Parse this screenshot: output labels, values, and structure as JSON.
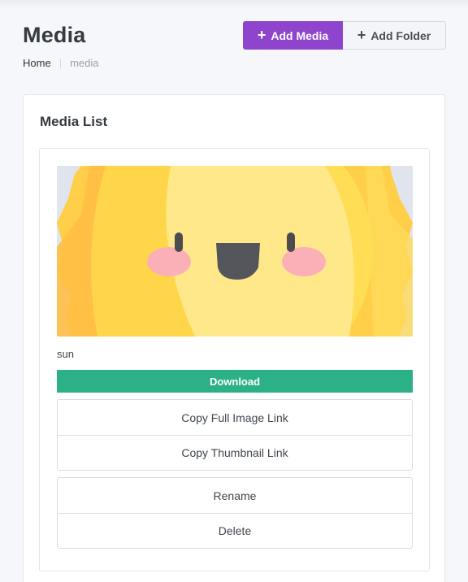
{
  "header": {
    "title": "Media",
    "add_media_label": "Add Media",
    "add_folder_label": "Add Folder"
  },
  "breadcrumb": {
    "home": "Home",
    "current": "media"
  },
  "card": {
    "title": "Media List"
  },
  "media_items": [
    {
      "name": "sun",
      "download_label": "Download",
      "copy_full_label": "Copy Full Image Link",
      "copy_thumb_label": "Copy Thumbnail Link",
      "rename_label": "Rename",
      "delete_label": "Delete"
    }
  ],
  "colors": {
    "accent": "#8e44cc",
    "download": "#2bb088",
    "background": "#f6f7fb"
  },
  "icons": {
    "add_media": "plus-icon",
    "add_folder": "plus-icon"
  }
}
